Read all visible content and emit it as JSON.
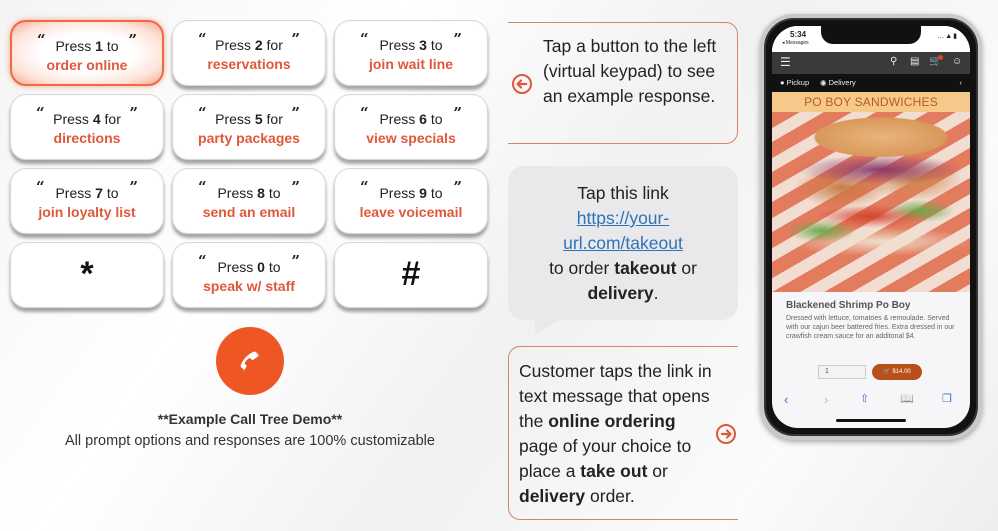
{
  "keypad": {
    "keys": [
      {
        "prefix": "Press ",
        "digit": "1",
        "suffix": " to",
        "action": "order online",
        "active": true
      },
      {
        "prefix": "Press ",
        "digit": "2",
        "suffix": " for",
        "action": "reservations",
        "active": false
      },
      {
        "prefix": "Press ",
        "digit": "3",
        "suffix": " to",
        "action": "join wait line",
        "active": false
      },
      {
        "prefix": "Press ",
        "digit": "4",
        "suffix": " for",
        "action": "directions",
        "active": false
      },
      {
        "prefix": "Press ",
        "digit": "5",
        "suffix": " for",
        "action": "party packages",
        "active": false
      },
      {
        "prefix": "Press ",
        "digit": "6",
        "suffix": " to",
        "action": "view specials",
        "active": false
      },
      {
        "prefix": "Press ",
        "digit": "7",
        "suffix": " to",
        "action": "join loyalty list",
        "active": false
      },
      {
        "prefix": "Press ",
        "digit": "8",
        "suffix": " to",
        "action": "send an email",
        "active": false
      },
      {
        "prefix": "Press ",
        "digit": "9",
        "suffix": " to",
        "action": "leave voicemail",
        "active": false
      },
      {
        "prefix": "Press ",
        "digit": "0",
        "suffix": " to",
        "action": "speak w/ staff",
        "active": false
      }
    ],
    "star_symbol": "*",
    "hash_symbol": "#",
    "open_quote": "“",
    "close_quote": "”"
  },
  "call": {
    "icon": "phone-icon",
    "title": "**Example Call Tree Demo**",
    "subtitle": "All prompt options and responses are 100% customizable"
  },
  "info_box": {
    "icon": "arrow-left-circle-icon",
    "text": "Tap a button to the left (virtual keypad) to see an example response."
  },
  "sms_bubble": {
    "line1": "Tap this link",
    "link_part1": "https://your-",
    "link_part2": "url.com/takeout",
    "line3_prefix": "to order ",
    "line3_bold": "takeout",
    "line3_suffix": " or",
    "line4_bold": "delivery",
    "line4_suffix": "."
  },
  "explain_box": {
    "icon": "arrow-right-circle-icon",
    "t1": "Customer taps the link in text message that opens the ",
    "b1": "online ordering",
    "t2": " page of your choice to place a ",
    "b2": "take out",
    "t3": " or ",
    "b3": "delivery",
    "t4": " order."
  },
  "phone": {
    "time": "5:34",
    "back_label": "◂ Messages",
    "status_icons": "…▲▮",
    "nav_icons": [
      "menu-icon",
      "search-icon",
      "document-icon",
      "cart-icon",
      "account-icon"
    ],
    "mode_pickup": "Pickup",
    "mode_delivery": "Delivery",
    "category": "PO BOY SANDWICHES",
    "item_name": "Blackened Shrimp Po Boy",
    "item_desc": "Dressed with lettuce, tomatoes & remoulade. Served with our cajun beer battered fries. Extra dressed in our crawfish cream sauce for an additonal $4.",
    "quantity": "1",
    "price_button": "🛒 $14.00"
  },
  "colors": {
    "accent": "#ee5724",
    "action_text": "#e0583a",
    "link": "#2e73b8",
    "bubble": "#e9e9eb",
    "box_border": "#d9846a"
  }
}
